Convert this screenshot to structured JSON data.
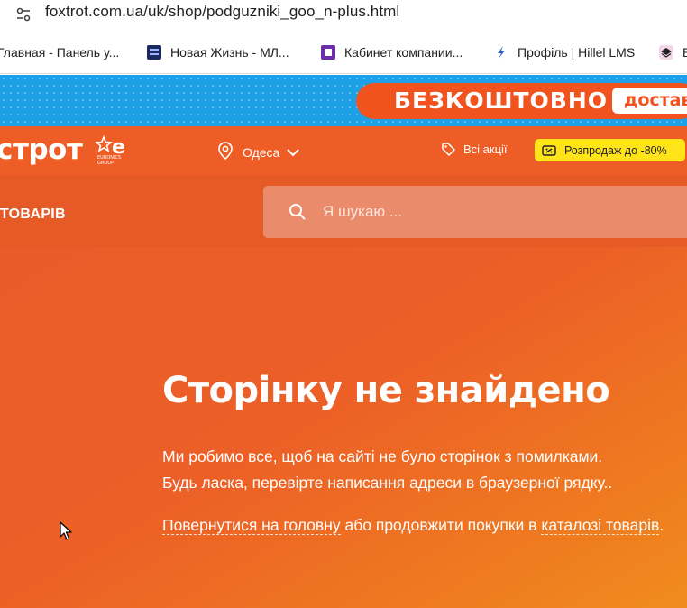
{
  "browser": {
    "url_host": "foxtrot.com.ua",
    "url_path": "/uk/shop/podguzniki_goo_n-plus.html",
    "bookmarks": [
      {
        "label": "Главная - Панель у...",
        "icon": "none"
      },
      {
        "label": "Новая Жизнь - МЛ...",
        "icon": "new-life-favicon"
      },
      {
        "label": "Кабинет компании...",
        "icon": "purple-square-favicon"
      },
      {
        "label": "Профіль | Hillel LMS",
        "icon": "hillel-favicon"
      },
      {
        "label": "Б",
        "icon": "layers-favicon"
      }
    ]
  },
  "promo": {
    "free_text": "БЕЗКОШТОВНО",
    "delivery_text": "достав"
  },
  "header": {
    "logo_text": "строт",
    "city": "Одеса",
    "all_promos": "Всі акції",
    "sale": "Розпродаж до -80%"
  },
  "nav": {
    "catalog": "ТОВАРІВ",
    "search_placeholder": "Я шукаю ..."
  },
  "error": {
    "title": "Сторінку не знайдено",
    "line1": "Ми робимо все, щоб на сайті не було сторінок з помилками.",
    "line2": "Будь ласка, перевірте написання адреси в браузерної рядку..",
    "home_link": "Повернутися на головну",
    "or_text": " або продовжити покупки в ",
    "catalog_link": "каталозі товарів",
    "period": "."
  },
  "colors": {
    "brand_orange": "#ed5d25",
    "promo_blue": "#1ea0e6",
    "sale_yellow": "#ffe41a"
  }
}
